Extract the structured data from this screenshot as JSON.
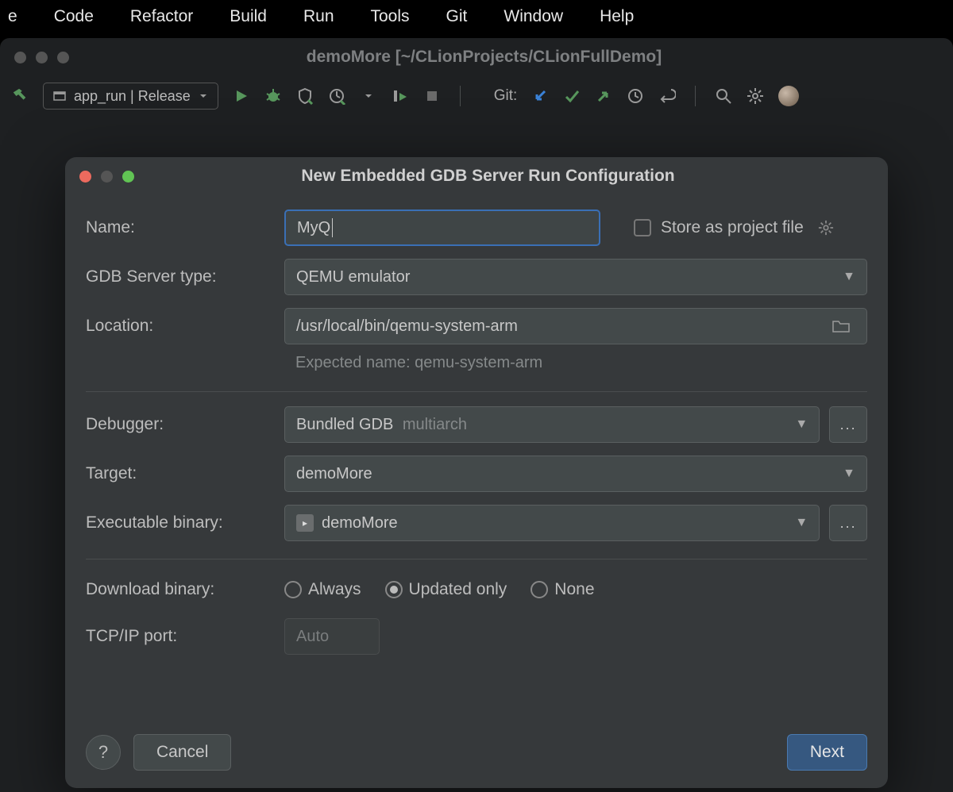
{
  "menubar": {
    "items": [
      "e",
      "Code",
      "Refactor",
      "Build",
      "Run",
      "Tools",
      "Git",
      "Window",
      "Help"
    ]
  },
  "ide": {
    "title": "demoMore [~/CLionProjects/CLionFullDemo]",
    "run_config": "app_run | Release",
    "git_label": "Git:"
  },
  "dialog": {
    "title": "New Embedded GDB Server Run Configuration",
    "name_label": "Name:",
    "name_value": "MyQ",
    "store_label": "Store as project file",
    "gdbtype_label": "GDB Server type:",
    "gdbtype_value": "QEMU emulator",
    "location_label": "Location:",
    "location_value": "/usr/local/bin/qemu-system-arm",
    "location_hint": "Expected name: qemu-system-arm",
    "debugger_label": "Debugger:",
    "debugger_value": "Bundled GDB",
    "debugger_suffix": "multiarch",
    "target_label": "Target:",
    "target_value": "demoMore",
    "exec_label": "Executable binary:",
    "exec_value": "demoMore",
    "download_label": "Download binary:",
    "download_options": {
      "always": "Always",
      "updated": "Updated only",
      "none": "None"
    },
    "port_label": "TCP/IP port:",
    "port_placeholder": "Auto",
    "cancel": "Cancel",
    "next": "Next"
  }
}
